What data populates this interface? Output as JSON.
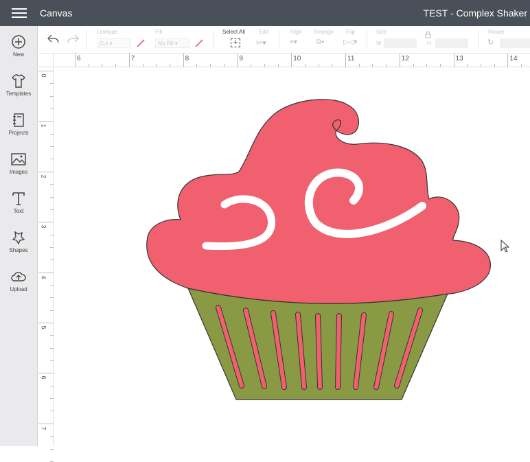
{
  "header": {
    "app_title": "Canvas",
    "document_title": "TEST - Complex Shaker"
  },
  "sidebar": {
    "items": [
      {
        "label": "New",
        "icon": "plus-circle-icon"
      },
      {
        "label": "Templates",
        "icon": "shirt-icon"
      },
      {
        "label": "Projects",
        "icon": "notebook-icon"
      },
      {
        "label": "Images",
        "icon": "image-icon"
      },
      {
        "label": "Text",
        "icon": "text-icon"
      },
      {
        "label": "Shapes",
        "icon": "shapes-icon"
      },
      {
        "label": "Upload",
        "icon": "cloud-upload-icon"
      }
    ]
  },
  "toolbar": {
    "linetype_label": "Linetype",
    "linetype_value": "Cut",
    "fill_label": "Fill",
    "fill_value": "No Fill",
    "select_all_label": "Select All",
    "edit_label": "Edit",
    "align_label": "Align",
    "arrange_label": "Arrange",
    "flip_label": "Flip",
    "size_label": "Size",
    "w_label": "W",
    "h_label": "H",
    "rotate_label": "Rotate",
    "pen_color": "#e57a8c"
  },
  "rulers": {
    "top": [
      "6",
      "7",
      "8",
      "9",
      "10",
      "11",
      "12",
      "13",
      "14"
    ],
    "left": [
      "0",
      "1",
      "2",
      "3",
      "4",
      "5",
      "6",
      "7"
    ]
  },
  "design": {
    "frosting_color": "#f0606e",
    "cup_color": "#8a9a44",
    "stripe_color": "#f0606e"
  }
}
